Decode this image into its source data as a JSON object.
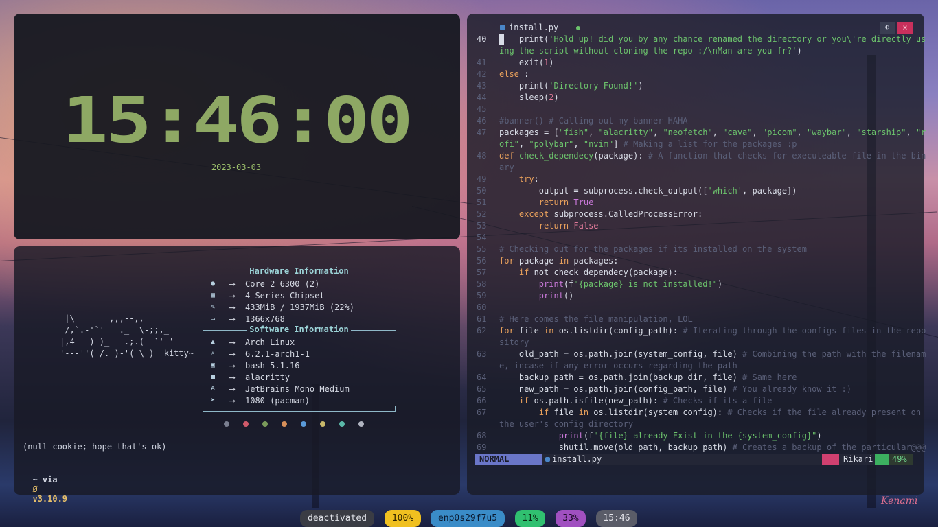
{
  "clock": {
    "time": "15:46:00",
    "date": "2023-03-03"
  },
  "neofetch": {
    "ascii_art": " |\\      _,,,--,,_\n /,`.-'`'   ._  \\-;;,_\n|,4-  ) )_   .;.(  `'-'\n'---''(_/._)-'(_\\_)  kitty~",
    "hardware_title": "Hardware Information",
    "software_title": "Software Information",
    "arrow": "⟶",
    "hardware": [
      {
        "icon": "cpu-icon",
        "glyph": "●",
        "value": "Core 2 6300 (2)"
      },
      {
        "icon": "chipset-icon",
        "glyph": "▦",
        "value": "4 Series Chipset"
      },
      {
        "icon": "memory-icon",
        "glyph": "✎",
        "value": "433MiB / 1937MiB (22%)"
      },
      {
        "icon": "display-icon",
        "glyph": "▭",
        "value": "1366x768"
      }
    ],
    "software": [
      {
        "icon": "arch-icon",
        "glyph": "▲",
        "value": "Arch Linux"
      },
      {
        "icon": "kernel-icon",
        "glyph": "♙",
        "value": "6.2.1-arch1-1"
      },
      {
        "icon": "shell-icon",
        "glyph": "▣",
        "value": "bash 5.1.16"
      },
      {
        "icon": "terminal-icon",
        "glyph": "■",
        "value": "alacritty"
      },
      {
        "icon": "font-icon",
        "glyph": "A",
        "value": "JetBrains Mono Medium"
      },
      {
        "icon": "package-icon",
        "glyph": "➤",
        "value": "1080 (pacman)"
      }
    ],
    "palette": [
      "#7a7f90",
      "#d05a6a",
      "#7a9a5a",
      "#d8905a",
      "#5a9ad8",
      "#c8b86a",
      "#5ab8a8",
      "#b0b4c0"
    ],
    "cookie_line": "(null cookie; hope that's ok)",
    "prompt_prefix": "~ via",
    "prompt_icon": "Ø",
    "prompt_version": "v3.10.9"
  },
  "editor": {
    "tab_filename": "install.py",
    "win_btn_toggle": "◐",
    "win_btn_close": "×",
    "mode": "NORMAL",
    "status_filename": "install.py",
    "user": "Rikari",
    "percent": "49%"
  },
  "taskbar": {
    "pills": [
      {
        "label": "deactivated",
        "bg": "#3a3c44",
        "fg": "#e0e2e8"
      },
      {
        "label": "100%",
        "bg": "#f0c020",
        "fg": "#2a2000"
      },
      {
        "label": "enp0s29f7u5",
        "bg": "#3a8cc8",
        "fg": "#0a1a30"
      },
      {
        "label": "11%",
        "bg": "#30c070",
        "fg": "#0a2a14"
      },
      {
        "label": "33%",
        "bg": "#a050c0",
        "fg": "#1a0a24"
      },
      {
        "label": "15:46",
        "bg": "#5a5c68",
        "fg": "#e8e8ee"
      }
    ],
    "watermark": "Kenami"
  }
}
